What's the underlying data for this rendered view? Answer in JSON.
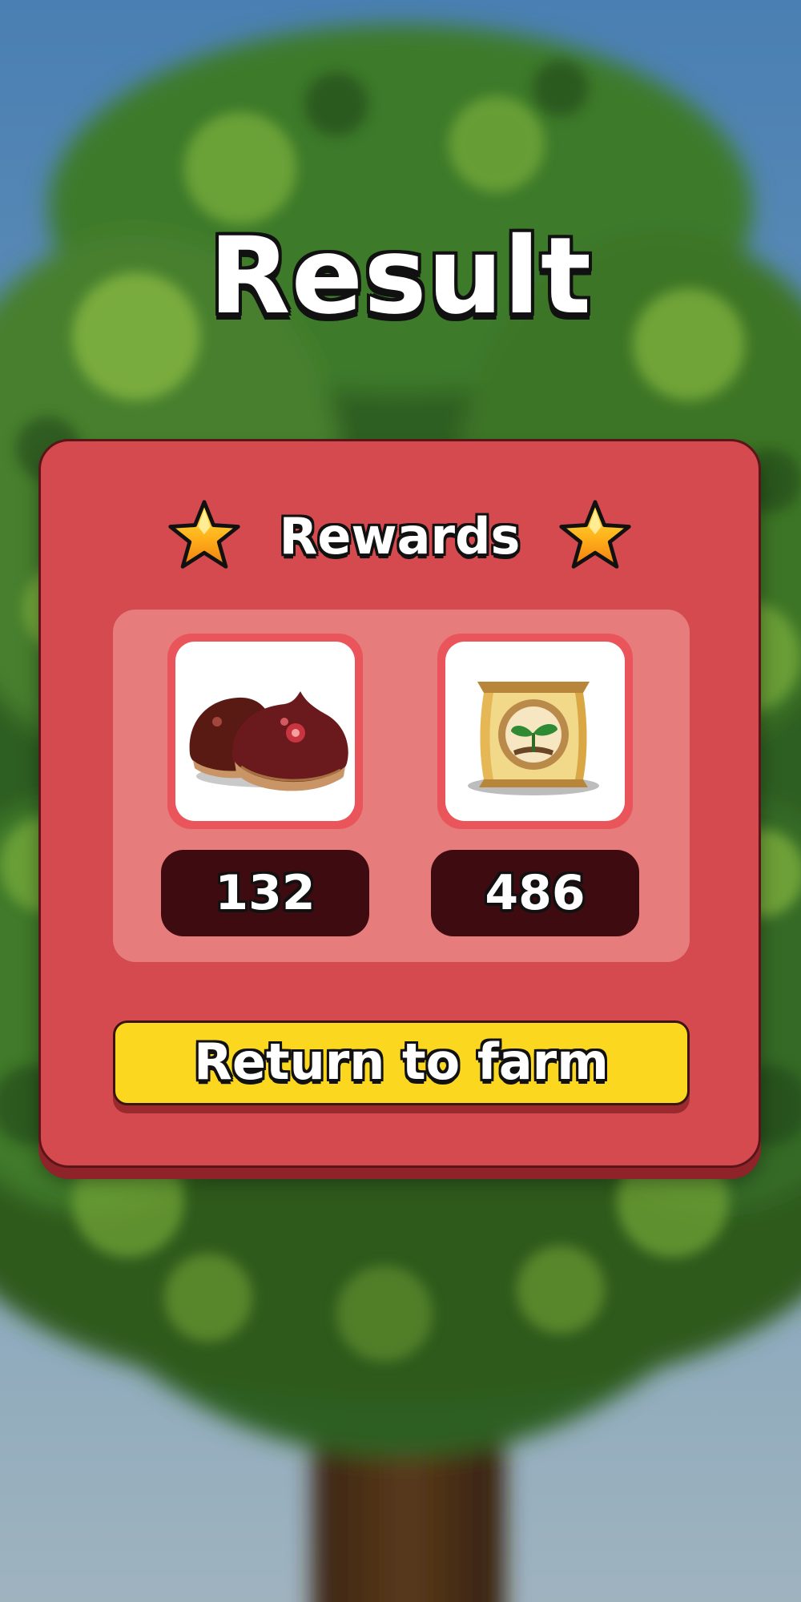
{
  "screen": {
    "title": "Result"
  },
  "rewards": {
    "label": "Rewards",
    "items": [
      {
        "name": "chestnut-icon",
        "count": "132"
      },
      {
        "name": "seed-bag-icon",
        "count": "486"
      }
    ]
  },
  "actions": {
    "return_label": "Return to farm"
  },
  "colors": {
    "panel": "#d44a4f",
    "rewards_box": "#e67c7c",
    "count_badge": "#3d0b10",
    "button": "#fbd81f",
    "sky": "#4f80b0",
    "foliage": "#3f7a2a"
  }
}
